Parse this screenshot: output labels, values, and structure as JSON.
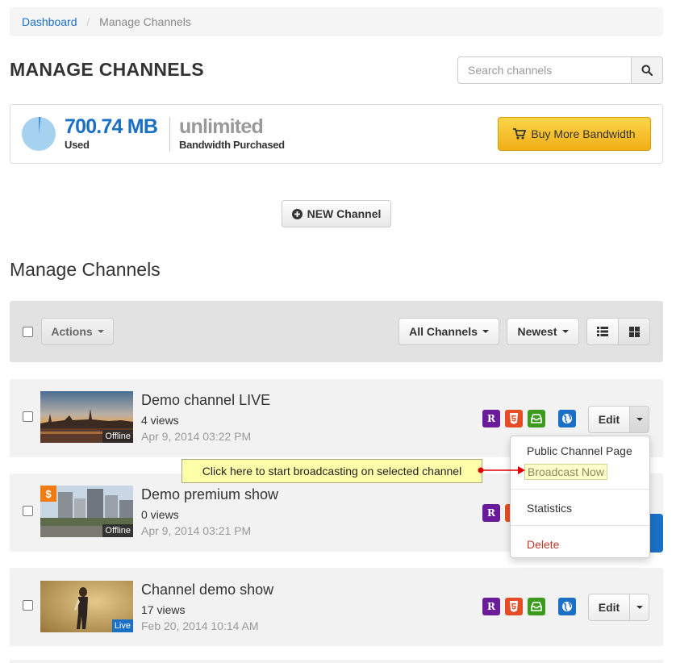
{
  "breadcrumb": {
    "home": "Dashboard",
    "current": "Manage Channels"
  },
  "page": {
    "title": "MANAGE CHANNELS",
    "section_title": "Manage Channels"
  },
  "search": {
    "placeholder": "Search channels"
  },
  "bandwidth": {
    "used_value": "700.74 MB",
    "used_label": "Used",
    "purchased_value": "unlimited",
    "purchased_label": "Bandwidth Purchased",
    "buy_label": "Buy More Bandwidth"
  },
  "new_channel_label": "NEW Channel",
  "toolbar": {
    "actions": "Actions",
    "filter": "All Channels",
    "sort": "Newest"
  },
  "channels": [
    {
      "title": "Demo channel LIVE",
      "views": "4 views",
      "date": "Apr 9, 2014 03:22 PM",
      "status": "Offline",
      "premium": false
    },
    {
      "title": "Demo premium show",
      "views": "0 views",
      "date": "Apr 9, 2014 03:21 PM",
      "status": "Offline",
      "premium": true
    },
    {
      "title": "Channel demo show",
      "views": "17 views",
      "date": "Feb 20, 2014 10:14 AM",
      "status": "Live",
      "premium": false
    }
  ],
  "premium_symbol": "$",
  "edit_label": "Edit",
  "dropdown": {
    "public_page": "Public Channel Page",
    "broadcast": "Broadcast Now",
    "statistics": "Statistics",
    "delete": "Delete"
  },
  "callout": {
    "text": "Click here to start broadcasting on selected channel"
  },
  "icon_letters": {
    "r": "R"
  },
  "colors": {
    "accent": "#1a6fc7",
    "buy_button": "#f5c02c",
    "premium": "#f07c14",
    "delete": "#c0392b"
  }
}
